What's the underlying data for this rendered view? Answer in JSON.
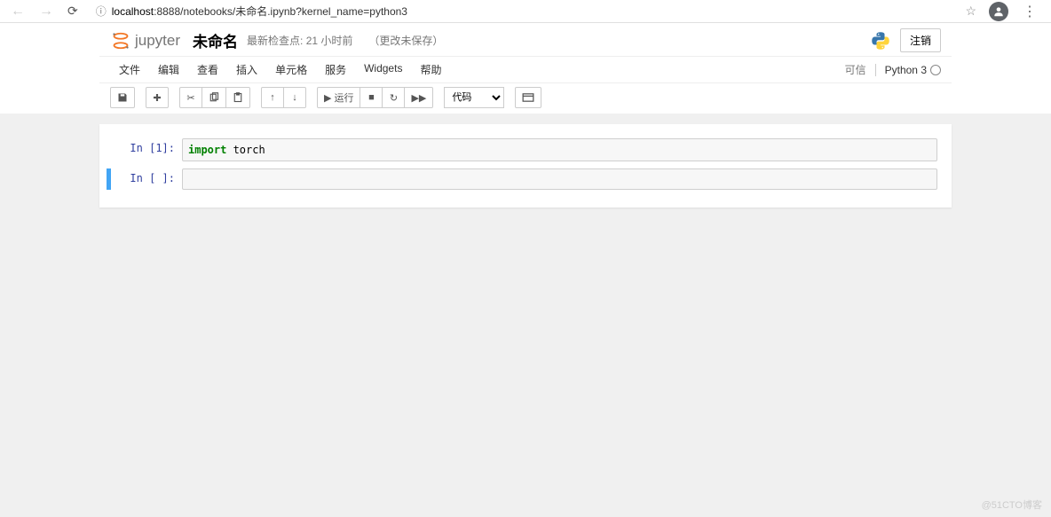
{
  "browser": {
    "url_host": "localhost",
    "url_rest": ":8888/notebooks/未命名.ipynb?kernel_name=python3"
  },
  "header": {
    "logo_text": "jupyter",
    "title": "未命名",
    "checkpoint": "最新检查点: 21 小时前",
    "autosave": "（更改未保存）",
    "logout": "注销"
  },
  "menus": [
    "文件",
    "编辑",
    "查看",
    "插入",
    "单元格",
    "服务",
    "Widgets",
    "帮助"
  ],
  "kernel": {
    "trusted": "可信",
    "name": "Python 3"
  },
  "toolbar": {
    "run_label": "运行",
    "cell_type": "代码"
  },
  "cells": [
    {
      "prompt": "In [1]:",
      "code_keyword": "import",
      "code_rest": " torch"
    },
    {
      "prompt": "In [ ]:",
      "code_keyword": "",
      "code_rest": ""
    }
  ],
  "watermark": "@51CTO博客"
}
